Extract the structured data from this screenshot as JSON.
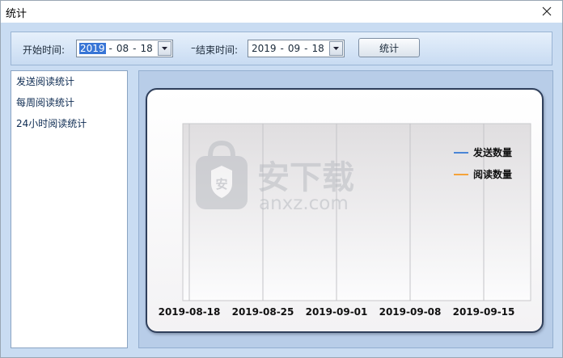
{
  "window": {
    "title": "统计"
  },
  "toolbar": {
    "start_label": "开始时间:",
    "start_date": {
      "year": "2019",
      "month": "08",
      "day": "18"
    },
    "dash": "–",
    "end_label": "结束时间:",
    "end_date": {
      "year": "2019",
      "month": "09",
      "day": "18"
    },
    "stats_button": "统计"
  },
  "sidebar": {
    "items": [
      {
        "label": "发送阅读统计"
      },
      {
        "label": "每周阅读统计"
      },
      {
        "label": "24小时阅读统计"
      }
    ]
  },
  "watermark": {
    "brand": "安下载",
    "domain": "anxz.com"
  },
  "chart_data": {
    "type": "line",
    "x_ticks": [
      "2019-08-18",
      "2019-08-25",
      "2019-09-01",
      "2019-09-08",
      "2019-09-15"
    ],
    "series": [
      {
        "name": "发送数量",
        "color": "#4a86d6",
        "values": []
      },
      {
        "name": "阅读数量",
        "color": "#f5a33a",
        "values": []
      }
    ],
    "legend_position": "top-right",
    "grid": "vertical"
  }
}
